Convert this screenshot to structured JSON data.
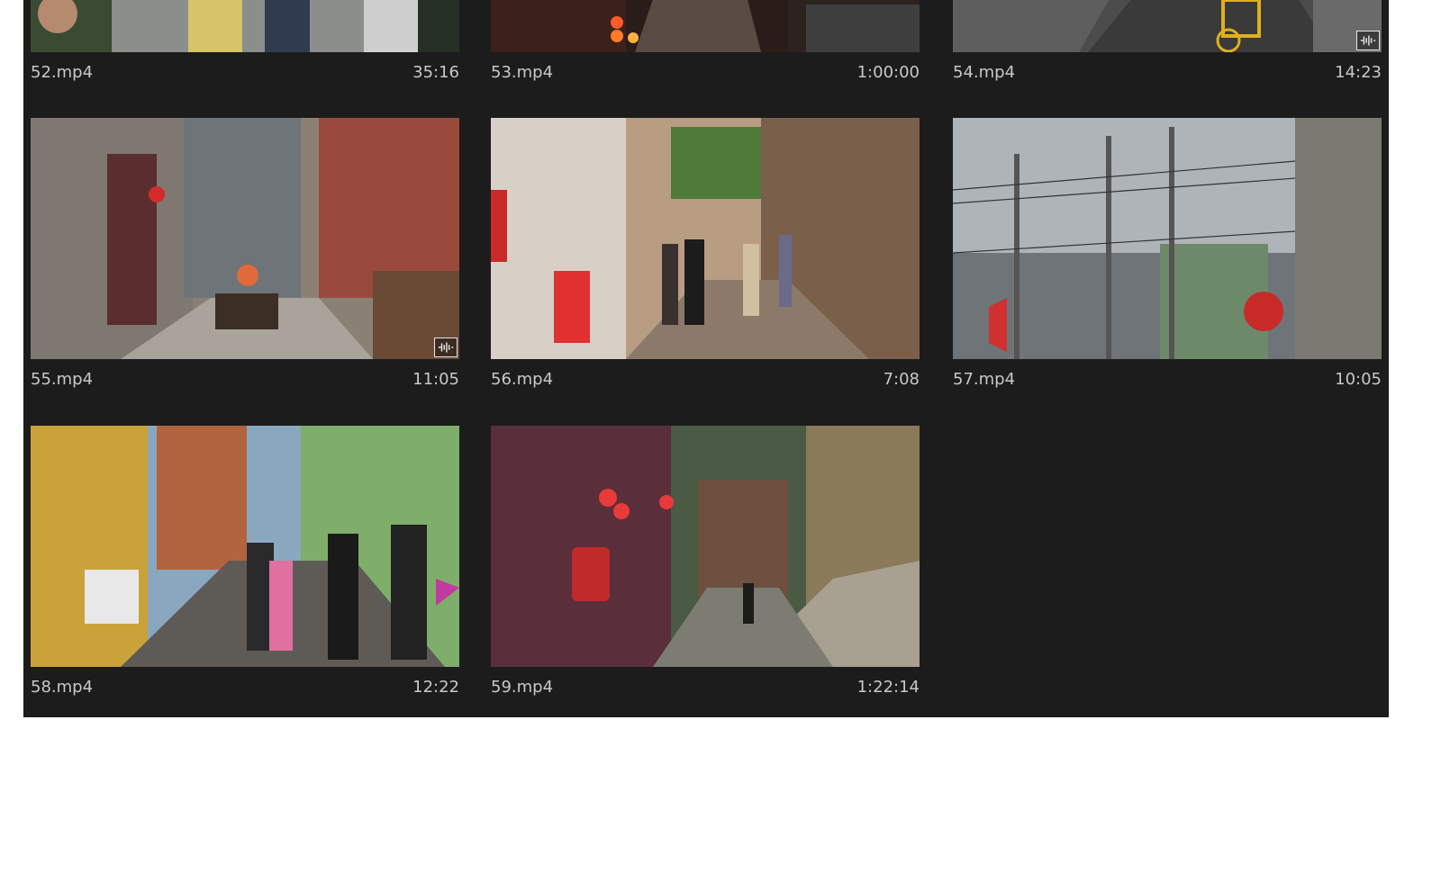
{
  "clips": [
    {
      "name": "52.mp4",
      "duration": "35:16",
      "scene": "street-scene"
    },
    {
      "name": "53.mp4",
      "duration": "1:00:00",
      "scene": "lantern-alley"
    },
    {
      "name": "54.mp4",
      "duration": "14:23",
      "scene": "bike-lane",
      "badge": true
    },
    {
      "name": "55.mp4",
      "duration": "11:05",
      "scene": "old-town-alley",
      "badge": true
    },
    {
      "name": "56.mp4",
      "duration": "7:08",
      "scene": "shopping-street"
    },
    {
      "name": "57.mp4",
      "duration": "10:05",
      "scene": "power-lines"
    },
    {
      "name": "58.mp4",
      "duration": "12:22",
      "scene": "market-street"
    },
    {
      "name": "59.mp4",
      "duration": "1:22:14",
      "scene": "tea-house-alley"
    }
  ],
  "icons": {
    "badge": "waveform-icon"
  }
}
